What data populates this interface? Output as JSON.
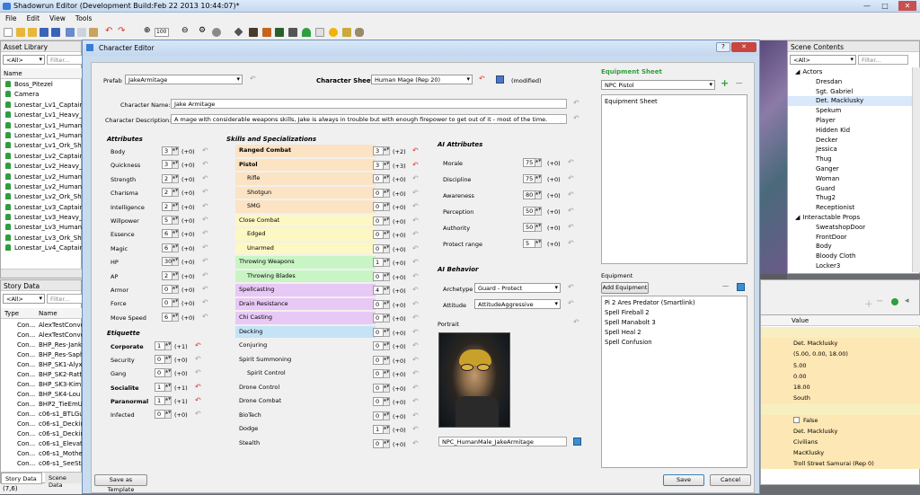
{
  "window": {
    "title": "Shadowrun Editor (Development Build:Feb 22 2013 10:44:07)*"
  },
  "menu": [
    "File",
    "Edit",
    "View",
    "Tools"
  ],
  "toolbar": {
    "zoom": "100"
  },
  "asset_library": {
    "title": "Asset Library",
    "filter_value": "<All>",
    "filter_placeholder": "Filter...",
    "column": "Name",
    "items": [
      "Boss_Pitezel",
      "Camera",
      "Lonestar_Lv1_Captain",
      "Lonestar_Lv1_Heavy_S",
      "Lonestar_Lv1_Human_",
      "Lonestar_Lv1_Human_",
      "Lonestar_Lv1_Ork_Sho",
      "Lonestar_Lv2_Captain",
      "Lonestar_Lv2_Heavy_S",
      "Lonestar_Lv2_Human_",
      "Lonestar_Lv2_Human_",
      "Lonestar_Lv2_Ork_Sho",
      "Lonestar_Lv3_Captain",
      "Lonestar_Lv3_Heavy_S",
      "Lonestar_Lv3_Human_",
      "Lonestar_Lv3_Ork_Sho",
      "Lonestar_Lv4_Captain"
    ]
  },
  "story_data": {
    "title": "Story Data",
    "filter_value": "<All>",
    "filter_placeholder": "Filter...",
    "columns": [
      "Type",
      "Name"
    ],
    "rows": [
      [
        "Con...",
        "AlexTestConve"
      ],
      [
        "Con...",
        "AlexTestConve"
      ],
      [
        "Con...",
        "BHP_Res-Jank"
      ],
      [
        "Con...",
        "BHP_Res-Saph"
      ],
      [
        "Con...",
        "BHP_SK1-Alyx"
      ],
      [
        "Con...",
        "BHP_SK2-Ratta"
      ],
      [
        "Con...",
        "BHP_SK3-Kim"
      ],
      [
        "Con...",
        "BHP_SK4-Lou"
      ],
      [
        "Con...",
        "BHP2_TieEmU"
      ],
      [
        "Con...",
        "c06-s1_BTLGuy"
      ],
      [
        "Con...",
        "c06-s1_Deckin"
      ],
      [
        "Con...",
        "c06-s1_Deckin"
      ],
      [
        "Con...",
        "c06-s1_Elevato"
      ],
      [
        "Con...",
        "c06-s1_Mother"
      ],
      [
        "Con...",
        "c06-s1_SeeStai"
      ]
    ],
    "tabs": [
      "Story Data",
      "Scene Data"
    ]
  },
  "status": "(7,6)",
  "scene_contents": {
    "title": "Scene Contents",
    "filter_value": "<All>",
    "filter_placeholder": "Filter...",
    "groups": [
      {
        "name": "Actors",
        "items": [
          "Dresdan",
          "Sgt. Gabriel",
          "Det. Macklusky",
          "Spekum",
          "Player",
          "Hidden Kid",
          "Decker",
          "Jessica",
          "Thug",
          "Ganger",
          "Woman",
          "Guard",
          "Thug2",
          "Receptionist"
        ]
      },
      {
        "name": "Interactable Props",
        "items": [
          "SweatshopDoor",
          "FrontDoor",
          "Body",
          "Bloody Cloth",
          "Locker3"
        ]
      }
    ]
  },
  "properties": {
    "column": "Value",
    "values": [
      "",
      "Det. Macklusky",
      "(5.00, 0.00, 18.00)",
      "5.00",
      "0.00",
      "18.00",
      "South",
      "",
      "False",
      "Det. Macklusky",
      "Civilians",
      "MacKlusky",
      "Troll Street Samurai (Rep 0)"
    ]
  },
  "dialog": {
    "title": "Character Editor",
    "prefab_label": "Prefab",
    "prefab": "JakeArmitage",
    "sheet_label": "Character Sheet",
    "sheet": "Human Mage (Rep 20)",
    "modified": "(modified)",
    "name_label": "Character Name:",
    "name": "Jake Armitage",
    "desc_label": "Character Description:",
    "desc": "A mage with considerable weapons skills, Jake is always in trouble but with enough firepower to get out of it - most of the time.",
    "attributes_header": "Attributes",
    "attributes": [
      {
        "name": "Body",
        "value": "3",
        "mod": "(+0)"
      },
      {
        "name": "Quickness",
        "value": "3",
        "mod": "(+0)"
      },
      {
        "name": "Strength",
        "value": "2",
        "mod": "(+0)"
      },
      {
        "name": "Charisma",
        "value": "2",
        "mod": "(+0)"
      },
      {
        "name": "Intelligence",
        "value": "2",
        "mod": "(+0)"
      },
      {
        "name": "Willpower",
        "value": "5",
        "mod": "(+0)"
      },
      {
        "name": "Essence",
        "value": "6",
        "mod": "(+0)"
      },
      {
        "name": "Magic",
        "value": "6",
        "mod": "(+0)"
      },
      {
        "name": "HP",
        "value": "30",
        "mod": "(+0)"
      },
      {
        "name": "AP",
        "value": "2",
        "mod": "(+0)"
      },
      {
        "name": "Armor",
        "value": "0",
        "mod": "(+0)"
      },
      {
        "name": "Force",
        "value": "0",
        "mod": "(+0)"
      },
      {
        "name": "Move Speed",
        "value": "6",
        "mod": "(+0)"
      }
    ],
    "etiquette_header": "Etiquette",
    "etiquette": [
      {
        "name": "Corporate",
        "value": "1",
        "mod": "(+1)",
        "bold": true
      },
      {
        "name": "Security",
        "value": "0",
        "mod": "(+0)"
      },
      {
        "name": "Gang",
        "value": "0",
        "mod": "(+0)"
      },
      {
        "name": "Socialite",
        "value": "1",
        "mod": "(+1)",
        "bold": true
      },
      {
        "name": "Paranormal",
        "value": "1",
        "mod": "(+1)",
        "bold": true
      },
      {
        "name": "Infected",
        "value": "0",
        "mod": "(+0)"
      }
    ],
    "skills_header": "Skills and Specializations",
    "skills": [
      {
        "name": "Ranged Combat",
        "value": "3",
        "mod": "(+2)",
        "bold": true,
        "indent": 0,
        "color": "#fbe3c4"
      },
      {
        "name": "Pistol",
        "value": "3",
        "mod": "(+3)",
        "bold": true,
        "indent": 0,
        "color": "#fbe3c4"
      },
      {
        "name": "Rifle",
        "value": "0",
        "mod": "(+0)",
        "indent": 1,
        "color": "#fbe3c4"
      },
      {
        "name": "Shotgun",
        "value": "0",
        "mod": "(+0)",
        "indent": 1,
        "color": "#fbe3c4"
      },
      {
        "name": "SMG",
        "value": "0",
        "mod": "(+0)",
        "indent": 1,
        "color": "#fbe3c4"
      },
      {
        "name": "Close Combat",
        "value": "0",
        "mod": "(+0)",
        "indent": 0,
        "color": "#fdf7c3"
      },
      {
        "name": "Edged",
        "value": "0",
        "mod": "(+0)",
        "indent": 1,
        "color": "#fdf7c3"
      },
      {
        "name": "Unarmed",
        "value": "0",
        "mod": "(+0)",
        "indent": 1,
        "color": "#fdf7c3"
      },
      {
        "name": "Throwing Weapons",
        "value": "1",
        "mod": "(+0)",
        "indent": 0,
        "color": "#c9f5c4"
      },
      {
        "name": "Throwing Blades",
        "value": "0",
        "mod": "(+0)",
        "indent": 1,
        "color": "#c9f5c4"
      },
      {
        "name": "Spellcasting",
        "value": "4",
        "mod": "(+0)",
        "indent": 0,
        "color": "#e8c8f5"
      },
      {
        "name": "Drain Resistance",
        "value": "0",
        "mod": "(+0)",
        "indent": 0,
        "color": "#e8c8f5"
      },
      {
        "name": "Chi Casting",
        "value": "0",
        "mod": "(+0)",
        "indent": 0,
        "color": "#e8c8f5"
      },
      {
        "name": "Decking",
        "value": "0",
        "mod": "(+0)",
        "indent": 0,
        "color": "#c4e3f7"
      },
      {
        "name": "Conjuring",
        "value": "0",
        "mod": "(+0)",
        "indent": 0,
        "color": ""
      },
      {
        "name": "Spirit Summoning",
        "value": "0",
        "mod": "(+0)",
        "indent": 0,
        "color": ""
      },
      {
        "name": "Spirit Control",
        "value": "0",
        "mod": "(+0)",
        "indent": 1,
        "color": ""
      },
      {
        "name": "Drone Control",
        "value": "0",
        "mod": "(+0)",
        "indent": 0,
        "color": ""
      },
      {
        "name": "Drone Combat",
        "value": "0",
        "mod": "(+0)",
        "indent": 0,
        "color": ""
      },
      {
        "name": "BioTech",
        "value": "0",
        "mod": "(+0)",
        "indent": 0,
        "color": ""
      },
      {
        "name": "Dodge",
        "value": "1",
        "mod": "(+0)",
        "indent": 0,
        "color": ""
      },
      {
        "name": "Stealth",
        "value": "0",
        "mod": "(+0)",
        "indent": 0,
        "color": ""
      }
    ],
    "ai_attr_header": "AI Attributes",
    "ai_attrs": [
      {
        "name": "Morale",
        "value": "75",
        "mod": "(+0)"
      },
      {
        "name": "Discipline",
        "value": "75",
        "mod": "(+0)"
      },
      {
        "name": "Awareness",
        "value": "80",
        "mod": "(+0)"
      },
      {
        "name": "Perception",
        "value": "50",
        "mod": "(+0)"
      },
      {
        "name": "Authority",
        "value": "50",
        "mod": "(+0)"
      },
      {
        "name": "Protect range",
        "value": "5",
        "mod": "(+0)"
      }
    ],
    "ai_behavior_header": "AI Behavior",
    "archetype_label": "Archetype",
    "archetype": "Guard - Protect",
    "attitude_label": "Attitude",
    "attitude": "AttitudeAggressive",
    "portrait_label": "Portrait",
    "portrait_file": "NPC_HumanMale_JakeArmitage",
    "equipment_sheet_header": "Equipment Sheet",
    "equipment_sheet_combo": "NPC Pistol",
    "equipment_sheet_list": [
      "Equipment Sheet"
    ],
    "equipment_label": "Equipment",
    "add_equipment": "Add Equipment",
    "equipment": [
      "Pi 2 Ares Predator (Smartlink)",
      "Spell Fireball 2",
      "Spell Manabolt 3",
      "Spell Heal 2",
      "Spell Confusion"
    ],
    "save_template": "Save as Template",
    "save": "Save",
    "cancel": "Cancel"
  }
}
